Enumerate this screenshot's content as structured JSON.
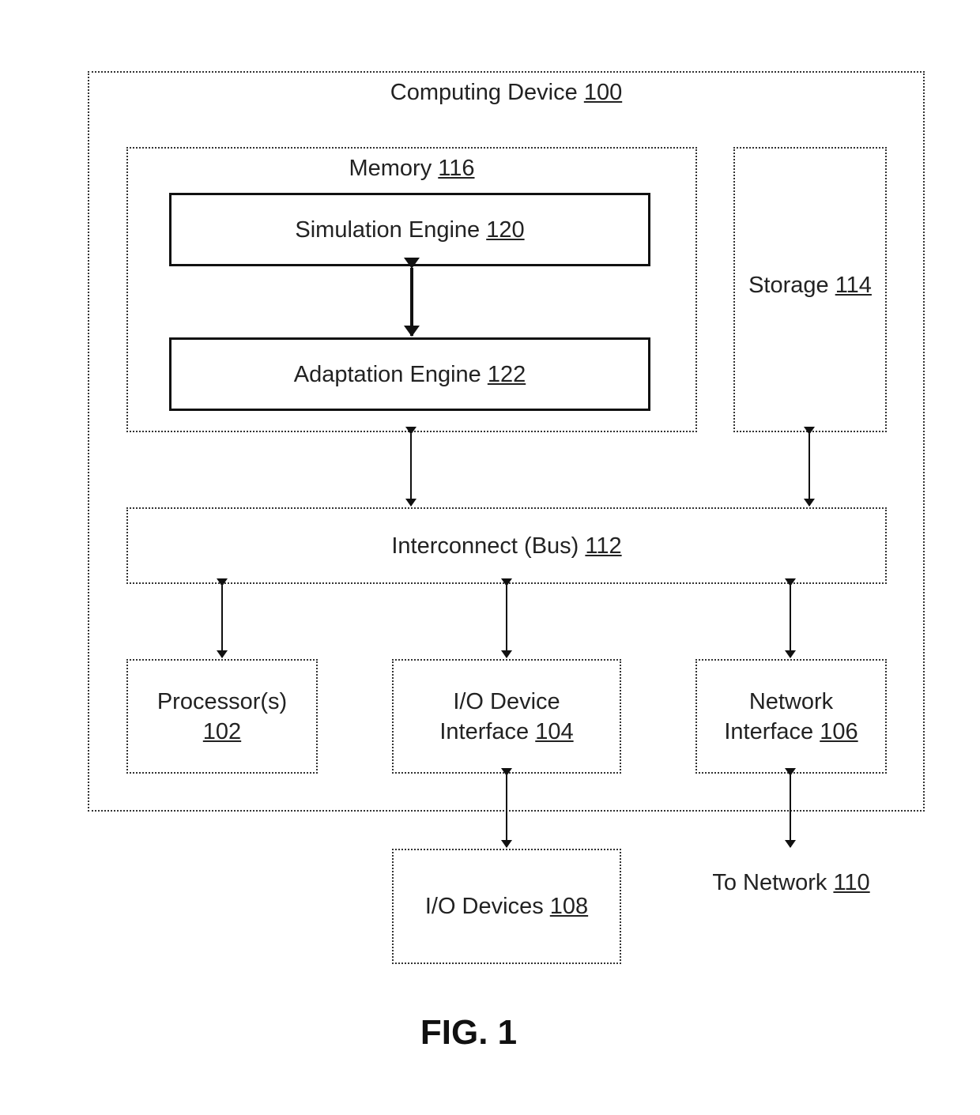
{
  "diagram": {
    "computing_device": {
      "name": "Computing Device",
      "ref": "100"
    },
    "memory": {
      "name": "Memory",
      "ref": "116"
    },
    "simulation_engine": {
      "name": "Simulation Engine",
      "ref": "120"
    },
    "adaptation_engine": {
      "name": "Adaptation Engine",
      "ref": "122"
    },
    "storage": {
      "name": "Storage",
      "ref": "114"
    },
    "interconnect": {
      "name": "Interconnect (Bus)",
      "ref": "112"
    },
    "processor": {
      "name": "Processor(s)",
      "ref": "102"
    },
    "io_interface": {
      "line1": "I/O Device",
      "line2": "Interface",
      "ref": "104"
    },
    "network_interface": {
      "line1": "Network",
      "line2": "Interface",
      "ref": "106"
    },
    "io_devices": {
      "name": "I/O Devices",
      "ref": "108"
    },
    "to_network": {
      "name": "To Network",
      "ref": "110"
    }
  },
  "figure_caption": "FIG. 1"
}
